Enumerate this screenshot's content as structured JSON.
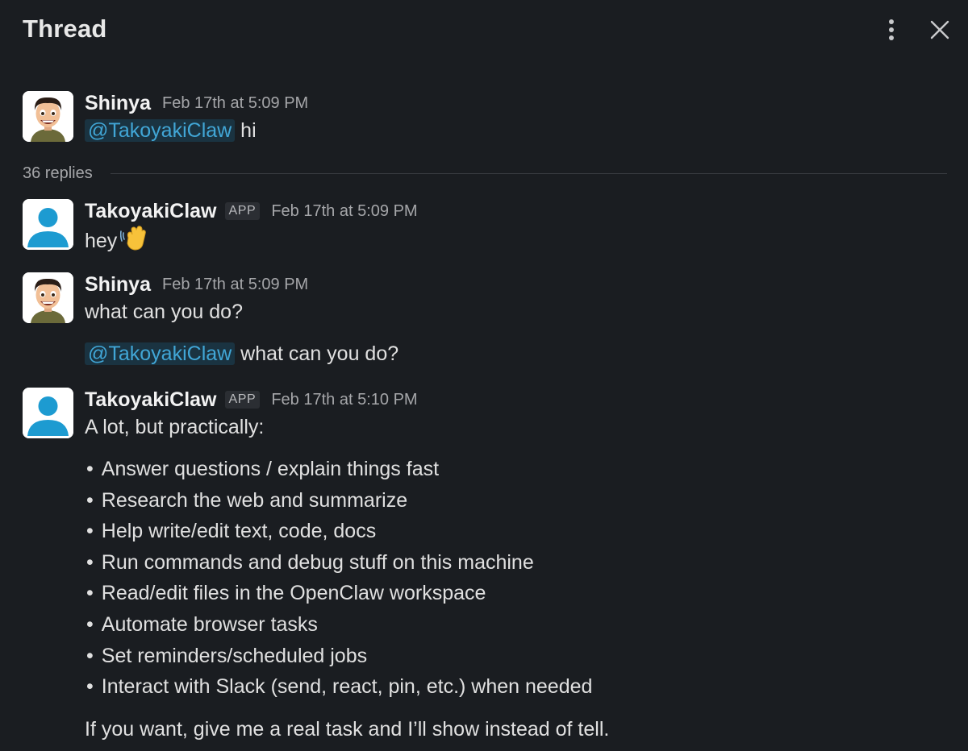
{
  "header": {
    "title": "Thread"
  },
  "messages": [
    {
      "author": "Shinya",
      "timestamp": "Feb 17th at 5:09 PM",
      "mention": "@TakoyakiClaw",
      "text": "hi"
    },
    {
      "author": "TakoyakiClaw",
      "badge": "APP",
      "timestamp": "Feb 17th at 5:09 PM",
      "text": "hey",
      "emoji": "waving-hand"
    },
    {
      "author": "Shinya",
      "timestamp": "Feb 17th at 5:09 PM",
      "text": "what can you do?",
      "mention": "@TakoyakiClaw",
      "text2": "what can you do?"
    },
    {
      "author": "TakoyakiClaw",
      "badge": "APP",
      "timestamp": "Feb 17th at 5:10 PM",
      "intro": "A lot, but practically:",
      "bullets": [
        "Answer questions / explain things fast",
        "Research the web and summarize",
        "Help write/edit text, code, docs",
        "Run commands and debug stuff on this machine",
        "Read/edit files in the OpenClaw workspace",
        "Automate browser tasks",
        "Set reminders/scheduled jobs",
        "Interact with Slack (send, react, pin, etc.) when needed"
      ],
      "outro": "If you want, give me a real task and I’ll show instead of tell."
    }
  ],
  "replies": {
    "count_label": "36 replies"
  },
  "colors": {
    "background": "#1a1d21",
    "mention": "#41a6d6",
    "bot_avatar": "#1d9bd1"
  }
}
